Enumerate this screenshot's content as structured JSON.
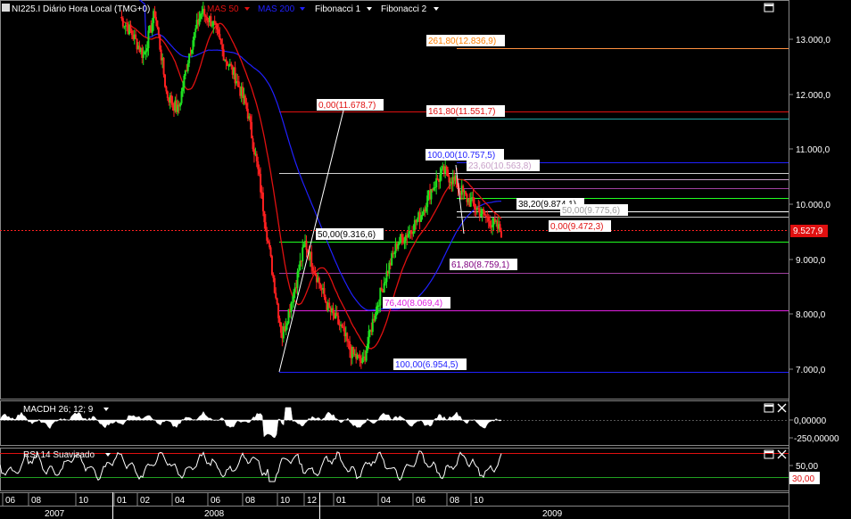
{
  "header": {
    "symbol": "NI225.I Diário Hora Local (TMG+0)",
    "indicators": [
      {
        "label": "MAS 50",
        "color": "#e01010"
      },
      {
        "label": "MAS 200",
        "color": "#2020ff"
      },
      {
        "label": "Fibonacci 1",
        "color": "#ffffff"
      },
      {
        "label": "Fibonacci 2",
        "color": "#ffffff"
      }
    ]
  },
  "price_axis": {
    "ticks": [
      "13.000,0",
      "12.000,0",
      "11.000,0",
      "10.000,0",
      "9.000,0",
      "8.000,0",
      "7.000,0"
    ],
    "current_price": "9.527,9"
  },
  "fibonacci_labels": [
    {
      "text": "261,80(12.836,9)",
      "color": "#ff9040"
    },
    {
      "text": "161,80(11.551,7)",
      "color": "#e01010"
    },
    {
      "text": "0,00(11.678,7)",
      "color": "#e01010"
    },
    {
      "text": "100,00(10.757,5)",
      "color": "#2020ff"
    },
    {
      "text": "23,60(10.563,8)",
      "color": "#c8a0c8"
    },
    {
      "text": "38,20(9.874,1)",
      "color": "#ffffff"
    },
    {
      "text": "50,00(9.775,6)",
      "color": "#c0c0c0"
    },
    {
      "text": "0,00(9.472,3)",
      "color": "#e01010"
    },
    {
      "text": "50,00(9.316,6)",
      "color": "#20ff20"
    },
    {
      "text": "61,80(8.759,1)",
      "color": "#a040a0"
    },
    {
      "text": "76,40(8.069,4)",
      "color": "#e020e0"
    },
    {
      "text": "100,00(6.954,5)",
      "color": "#2020ff"
    }
  ],
  "macd": {
    "label": "MACDH 26; 12; 9",
    "ticks": [
      "0,00000",
      "-250,00000"
    ]
  },
  "rsi": {
    "label": "RSI 14 Suavizado",
    "ticks": [
      "50,00",
      "30,00"
    ]
  },
  "time_axis": {
    "months": [
      "06",
      "08",
      "10",
      "01",
      "02",
      "04",
      "06",
      "08",
      "10",
      "12",
      "01",
      "04",
      "06",
      "08",
      "10"
    ],
    "years": [
      "2007",
      "2008",
      "2009"
    ]
  },
  "chart_data": {
    "type": "candlestick",
    "y_range": [
      6800,
      13700
    ],
    "y_ticks": [
      13000,
      12000,
      11000,
      10000,
      9000,
      8000,
      7000
    ],
    "current_price": 9527.9,
    "moving_averages": [
      {
        "name": "MAS 50",
        "color": "#e01010"
      },
      {
        "name": "MAS 200",
        "color": "#2020ff"
      }
    ],
    "fibonacci_levels": [
      12836.9,
      11678.7,
      11551.7,
      10757.5,
      10563.8,
      9874.1,
      9775.6,
      9472.3,
      9316.6,
      8759.1,
      8069.4,
      6954.5
    ],
    "close_path": [
      13400,
      13100,
      12700,
      13500,
      12000,
      11700,
      12800,
      13500,
      13300,
      12700,
      12300,
      11700,
      10500,
      9000,
      7600,
      8400,
      9300,
      8700,
      8100,
      7800,
      7300,
      7100,
      8000,
      8700,
      9300,
      9500,
      9800,
      10300,
      10600,
      10400,
      10100,
      9900,
      9700,
      9500
    ]
  }
}
